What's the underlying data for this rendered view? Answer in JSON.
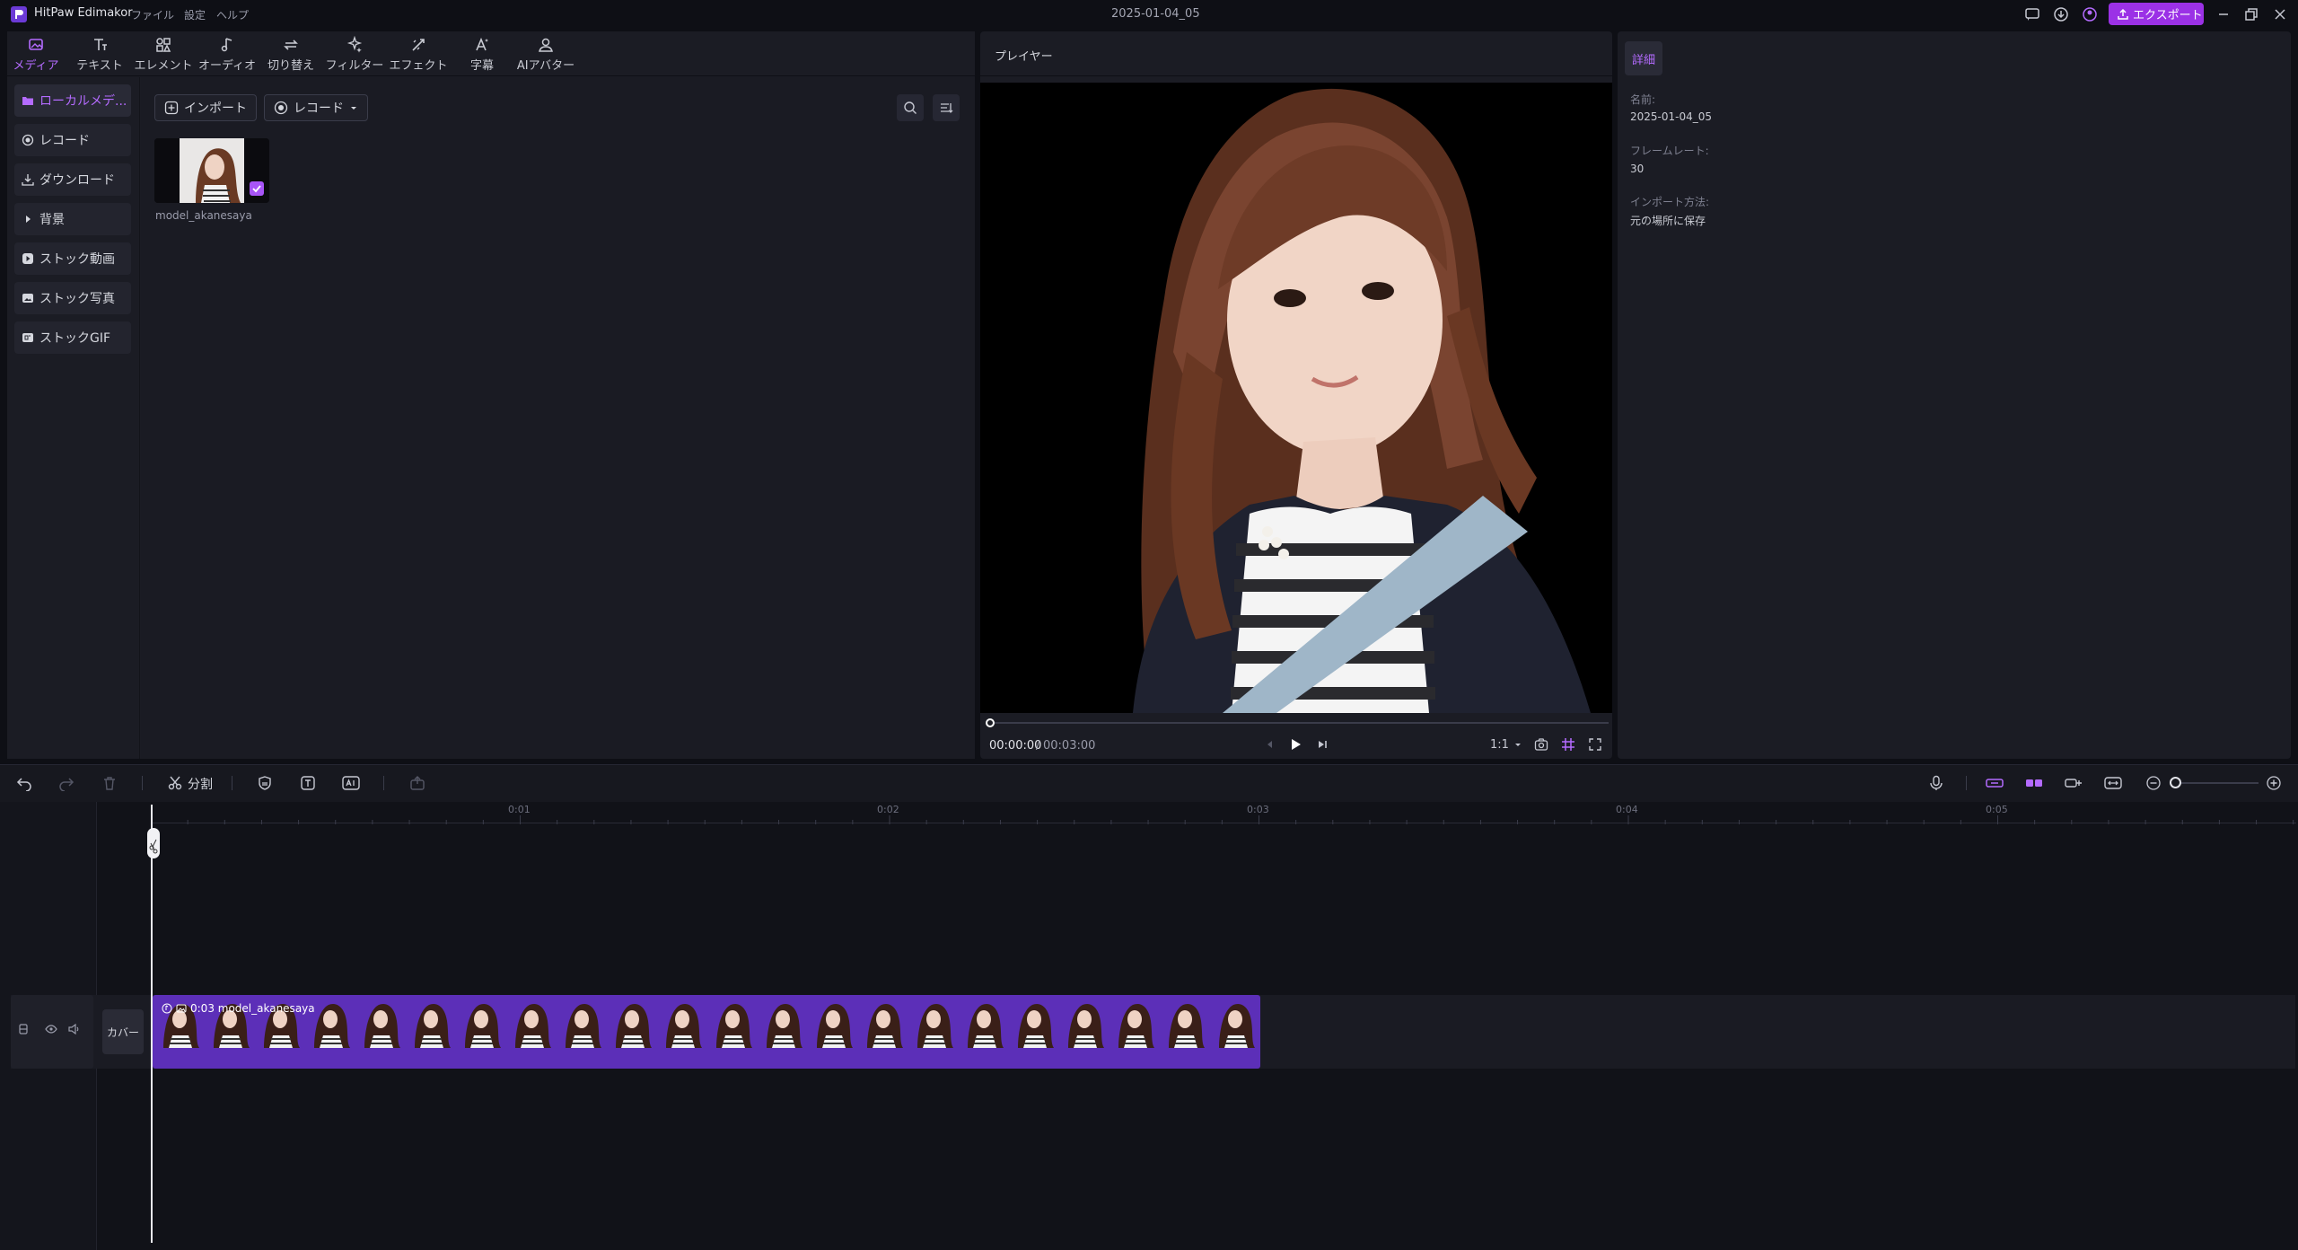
{
  "titlebar": {
    "app_name": "HitPaw Edimakor",
    "menus": [
      "ファイル",
      "設定",
      "ヘルプ"
    ],
    "document_title": "2025-01-04_05",
    "export_label": "エクスポート"
  },
  "tabs": [
    {
      "label": "メディア",
      "icon": "media-icon",
      "active": true
    },
    {
      "label": "テキスト",
      "icon": "text-icon"
    },
    {
      "label": "エレメント",
      "icon": "element-icon"
    },
    {
      "label": "オーディオ",
      "icon": "audio-icon"
    },
    {
      "label": "切り替え",
      "icon": "transition-icon"
    },
    {
      "label": "フィルター",
      "icon": "filter-icon"
    },
    {
      "label": "エフェクト",
      "icon": "effect-icon"
    },
    {
      "label": "字幕",
      "icon": "subtitle-icon"
    },
    {
      "label": "AIアバター",
      "icon": "avatar-icon"
    }
  ],
  "sidebar": {
    "items": [
      {
        "label": "ローカルメデ...",
        "icon": "folder-icon",
        "active": true
      },
      {
        "label": "レコード",
        "icon": "record-icon"
      },
      {
        "label": "ダウンロード",
        "icon": "download-icon"
      },
      {
        "label": "背景",
        "icon": "triangle-right-icon"
      },
      {
        "label": "ストック動画",
        "icon": "play-icon"
      },
      {
        "label": "ストック写真",
        "icon": "image-icon"
      },
      {
        "label": "ストックGIF",
        "icon": "gif-icon"
      }
    ]
  },
  "media": {
    "import_label": "インポート",
    "record_label": "レコード",
    "items": [
      {
        "name": "model_akanesaya",
        "selected": true
      }
    ]
  },
  "player": {
    "title": "プレイヤー",
    "time_current": "00:00:00",
    "time_separator": "/",
    "time_total": "00:03:00",
    "ratio": "1:1",
    "progress": 0
  },
  "details": {
    "tab_label": "詳細",
    "fields": [
      {
        "label": "名前:",
        "value": "2025-01-04_05"
      },
      {
        "label": "フレームレート:",
        "value": "30"
      },
      {
        "label": "インポート方法:",
        "value": "元の場所に保存"
      }
    ]
  },
  "timeline": {
    "split_label": "分割",
    "ruler": [
      "0:01",
      "0:02",
      "0:03",
      "0:04",
      "0:05"
    ],
    "cover_label": "カバー",
    "clip": {
      "label": "0:03 model_akanesaya",
      "duration_seconds": 3
    }
  },
  "colors": {
    "accent": "#9b31e6",
    "clip": "#5c2fb8",
    "active_text": "#b46bff"
  }
}
